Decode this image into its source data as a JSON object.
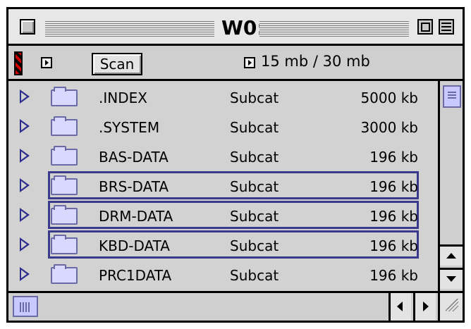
{
  "window": {
    "title": "W0:"
  },
  "toolbar": {
    "scan_label": "Scan",
    "storage": "15 mb / 30 mb"
  },
  "files": [
    {
      "name": ".INDEX",
      "kind": "Subcat",
      "size": "5000 kb",
      "selected": false
    },
    {
      "name": ".SYSTEM",
      "kind": "Subcat",
      "size": "3000 kb",
      "selected": false
    },
    {
      "name": "BAS-DATA",
      "kind": "Subcat",
      "size": "196 kb",
      "selected": false
    },
    {
      "name": "BRS-DATA",
      "kind": "Subcat",
      "size": "196 kb",
      "selected": true
    },
    {
      "name": "DRM-DATA",
      "kind": "Subcat",
      "size": "196 kb",
      "selected": true
    },
    {
      "name": "KBD-DATA",
      "kind": "Subcat",
      "size": "196 kb",
      "selected": true
    },
    {
      "name": "PRC1DATA",
      "kind": "Subcat",
      "size": "196 kb",
      "selected": false
    }
  ],
  "icons": {
    "close": "close-box-icon",
    "zoom": "zoom-box-icon",
    "collapse": "collapse-box-icon",
    "disclosure": "disclosure-triangle-icon",
    "folder": "folder-icon",
    "popup": "popup-arrow-icon",
    "grow": "grow-box-icon"
  },
  "colors": {
    "selection_border": "#3a3a8c",
    "folder_fill": "#d9d9ff",
    "scroll_thumb": "#c9c9ff",
    "disclosure": "#2d2d8e"
  }
}
